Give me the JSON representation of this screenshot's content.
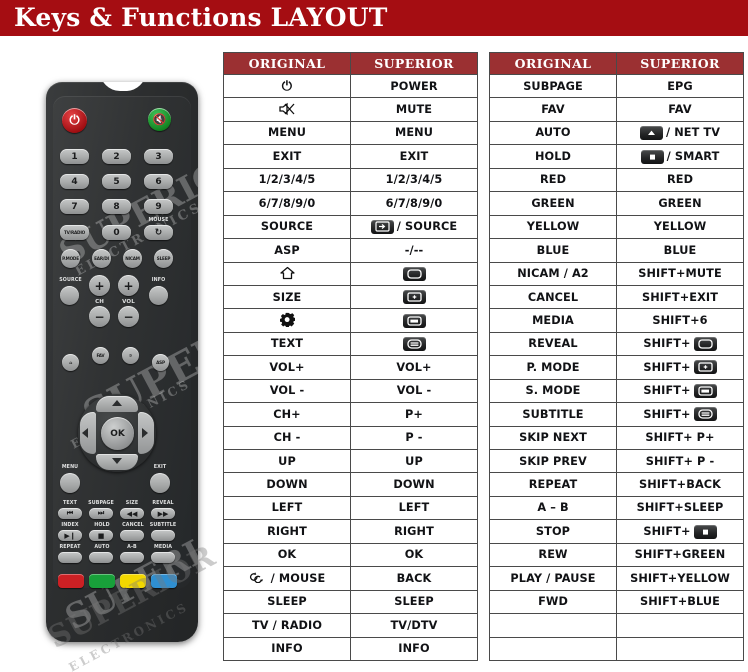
{
  "header": {
    "title": "Keys & Functions LAYOUT",
    "bar_color": "#a50d12"
  },
  "colors": {
    "table_header": "#9b3032",
    "border": "#4a4a4a",
    "badge_dark": "#232425"
  },
  "remote": {
    "brand_watermark": "SUPERIOR",
    "brand_watermark_sub": "ELECTRONICS",
    "buttons": {
      "power": "power-icon",
      "mute": "mute-icon",
      "num_1": "1",
      "num_2": "2",
      "num_3": "3",
      "num_4": "4",
      "num_5": "5",
      "num_6": "6",
      "num_7": "7",
      "num_8": "8",
      "num_9": "9",
      "num_0": "0",
      "tv_radio": "TV/RADIO",
      "mouse_label": "MOUSE",
      "pmode": "P.MODE",
      "eartv": "EAR/DI",
      "nicam": "NICAM A2",
      "sleep": "SLEEP",
      "source": "SOURCE",
      "info": "INFO",
      "ch": "CH",
      "vol": "VOL",
      "fav": "FAV",
      "menu": "MENU",
      "exit": "EXIT",
      "ok": "OK",
      "text": "TEXT",
      "subpage": "SUBPAGE",
      "size": "SIZE",
      "reveal": "REVEAL",
      "index": "INDEX",
      "hold": "HOLD",
      "cancel": "CANCEL",
      "subtitle": "SUBTITLE",
      "repeat": "REPEAT",
      "auto": "AUTO",
      "ab": "A-B",
      "media": "MEDIA"
    },
    "color_keys": [
      {
        "name": "red",
        "hex": "#cc2024"
      },
      {
        "name": "green",
        "hex": "#18a03a"
      },
      {
        "name": "yellow",
        "hex": "#f2d700"
      },
      {
        "name": "blue",
        "hex": "#2f8fd1"
      }
    ]
  },
  "tables": [
    {
      "id": "table-left",
      "columns": [
        "ORIGINAL",
        "SUPERIOR"
      ],
      "rows": [
        {
          "original": "",
          "original_icon": "power-icon",
          "superior": "POWER"
        },
        {
          "original": "",
          "original_icon": "mute-icon",
          "superior": "MUTE"
        },
        {
          "original": "MENU",
          "superior": "MENU"
        },
        {
          "original": "EXIT",
          "superior": "EXIT"
        },
        {
          "original": "1/2/3/4/5",
          "superior": "1/2/3/4/5"
        },
        {
          "original": "6/7/8/9/0",
          "superior": "6/7/8/9/0"
        },
        {
          "original": "SOURCE",
          "superior": "/ SOURCE",
          "superior_icon": "source-badge-icon"
        },
        {
          "original": "ASP",
          "superior": "-/--"
        },
        {
          "original": "",
          "original_icon": "home-icon",
          "superior": "",
          "superior_icon": "screen-badge-icon"
        },
        {
          "original": "SIZE",
          "superior": "",
          "superior_icon": "zoom-badge-icon"
        },
        {
          "original": "",
          "original_icon": "gear-icon",
          "superior": "",
          "superior_icon": "pmode-badge-icon"
        },
        {
          "original": "TEXT",
          "superior": "",
          "superior_icon": "smode-badge-icon"
        },
        {
          "original": "VOL+",
          "superior": "VOL+"
        },
        {
          "original": "VOL -",
          "superior": "VOL -"
        },
        {
          "original": "CH+",
          "superior": "P+"
        },
        {
          "original": "CH -",
          "superior": "P -"
        },
        {
          "original": "UP",
          "superior": "UP"
        },
        {
          "original": "DOWN",
          "superior": "DOWN"
        },
        {
          "original": "LEFT",
          "superior": "LEFT"
        },
        {
          "original": "RIGHT",
          "superior": "RIGHT"
        },
        {
          "original": "OK",
          "superior": "OK"
        },
        {
          "original": "/ MOUSE",
          "original_icon": "mouse-cycle-icon",
          "superior": "BACK"
        },
        {
          "original": "SLEEP",
          "superior": "SLEEP"
        },
        {
          "original": "TV / RADIO",
          "superior": "TV/DTV"
        },
        {
          "original": "INFO",
          "superior": "INFO"
        }
      ]
    },
    {
      "id": "table-right",
      "columns": [
        "ORIGINAL",
        "SUPERIOR"
      ],
      "rows": [
        {
          "original": "SUBPAGE",
          "superior": "EPG"
        },
        {
          "original": "FAV",
          "superior": "FAV"
        },
        {
          "original": "AUTO",
          "superior": "/ NET TV",
          "superior_icon": "up-badge-icon"
        },
        {
          "original": "HOLD",
          "superior": "/ SMART",
          "superior_icon": "stop-badge-icon"
        },
        {
          "original": "RED",
          "superior": "RED"
        },
        {
          "original": "GREEN",
          "superior": "GREEN"
        },
        {
          "original": "YELLOW",
          "superior": "YELLOW"
        },
        {
          "original": "BLUE",
          "superior": "BLUE"
        },
        {
          "original": "NICAM / A2",
          "superior": "SHIFT+MUTE"
        },
        {
          "original": "CANCEL",
          "superior": "SHIFT+EXIT"
        },
        {
          "original": "MEDIA",
          "superior": "SHIFT+6"
        },
        {
          "original": "REVEAL",
          "superior": "SHIFT+",
          "superior_icon": "screen-badge-icon"
        },
        {
          "original": "P. MODE",
          "superior": "SHIFT+",
          "superior_icon": "zoom-badge-icon"
        },
        {
          "original": "S. MODE",
          "superior": "SHIFT+",
          "superior_icon": "pmode-badge-icon"
        },
        {
          "original": "SUBTITLE",
          "superior": "SHIFT+",
          "superior_icon": "smode-badge-icon"
        },
        {
          "original": "SKIP NEXT",
          "superior": "SHIFT+ P+"
        },
        {
          "original": "SKIP PREV",
          "superior": "SHIFT+ P -"
        },
        {
          "original": "REPEAT",
          "superior": "SHIFT+BACK"
        },
        {
          "original": "A – B",
          "superior": "SHIFT+SLEEP"
        },
        {
          "original": "STOP",
          "superior": "SHIFT+",
          "superior_icon": "stop-badge-icon"
        },
        {
          "original": "REW",
          "superior": "SHIFT+GREEN"
        },
        {
          "original": "PLAY / PAUSE",
          "superior": "SHIFT+YELLOW"
        },
        {
          "original": "FWD",
          "superior": "SHIFT+BLUE"
        },
        {
          "original": "",
          "superior": ""
        },
        {
          "original": "",
          "superior": ""
        }
      ]
    }
  ]
}
